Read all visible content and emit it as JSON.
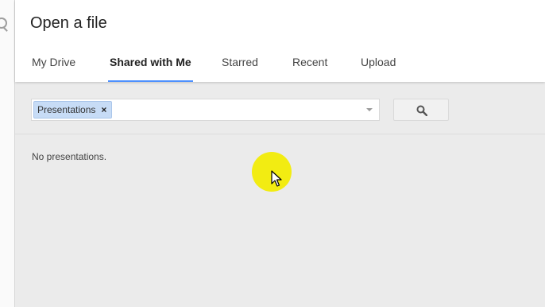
{
  "dialog": {
    "title": "Open a file"
  },
  "tabs": [
    {
      "label": "My Drive",
      "active": false
    },
    {
      "label": "Shared with Me",
      "active": true
    },
    {
      "label": "Starred",
      "active": false
    },
    {
      "label": "Recent",
      "active": false
    },
    {
      "label": "Upload",
      "active": false
    }
  ],
  "search": {
    "filter_chip": "Presentations",
    "chip_close": "×",
    "value": ""
  },
  "results": {
    "empty_message": "No presentations."
  },
  "colors": {
    "active_tab_underline": "#4d90fe",
    "chip_background": "#c7dcf6",
    "cursor_highlight": "#f2ec12"
  },
  "icons": {
    "search_button": "search-icon",
    "dropdown": "chevron-down-icon",
    "cursor": "mouse-pointer-icon"
  }
}
